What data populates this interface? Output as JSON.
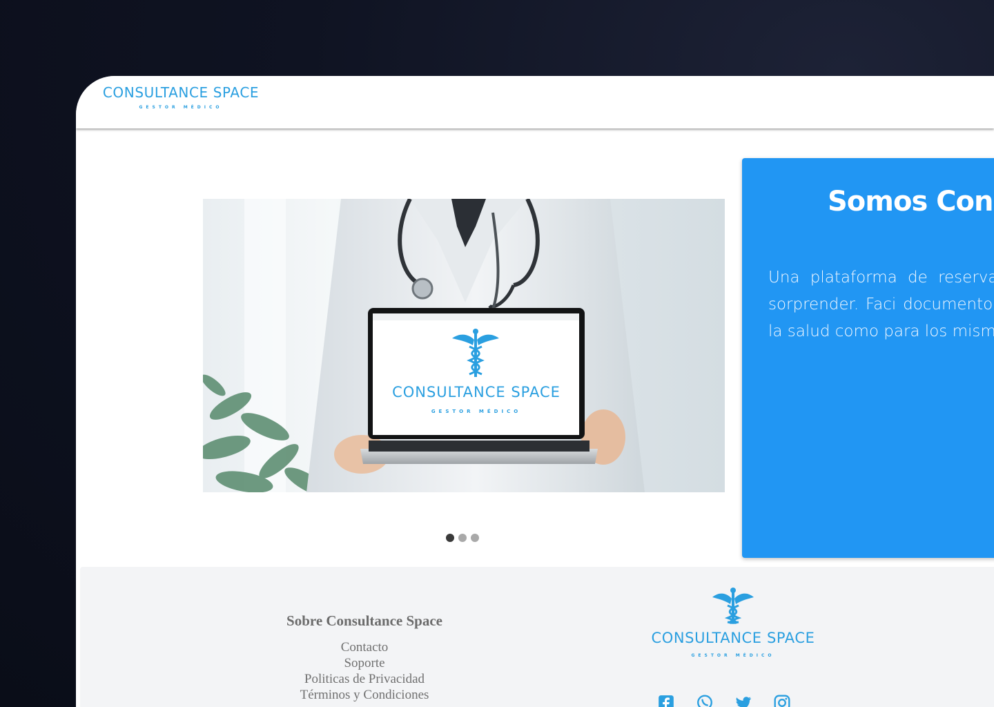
{
  "header": {
    "brand_name": "CONSULTANCE SPACE",
    "brand_subtitle": "GESTOR MÉDICO"
  },
  "carousel": {
    "slide_screen_brand": "CONSULTANCE SPACE",
    "slide_screen_subtitle": "GESTOR MÉDICO",
    "slides": 3,
    "active_slide": 1
  },
  "hero": {
    "title": "Somos Consu",
    "text": "Una plataforma de reserva y g que te va a sorprender. Faci documentos, y pagos. Pensada la salud como para los mismos"
  },
  "footer": {
    "heading": "Sobre Consultance Space",
    "links": [
      "Contacto",
      "Soporte",
      "Politicas de Privacidad",
      "Términos y Condiciones"
    ],
    "brand_name": "CONSULTANCE SPACE",
    "brand_subtitle": "GESTOR MÉDICO",
    "socials": [
      "facebook-icon",
      "whatsapp-icon",
      "twitter-icon",
      "instagram-icon"
    ]
  },
  "colors": {
    "brand_blue": "#2a9fe0",
    "hero_blue": "#2196f3",
    "footer_bg": "#f3f4f6"
  }
}
